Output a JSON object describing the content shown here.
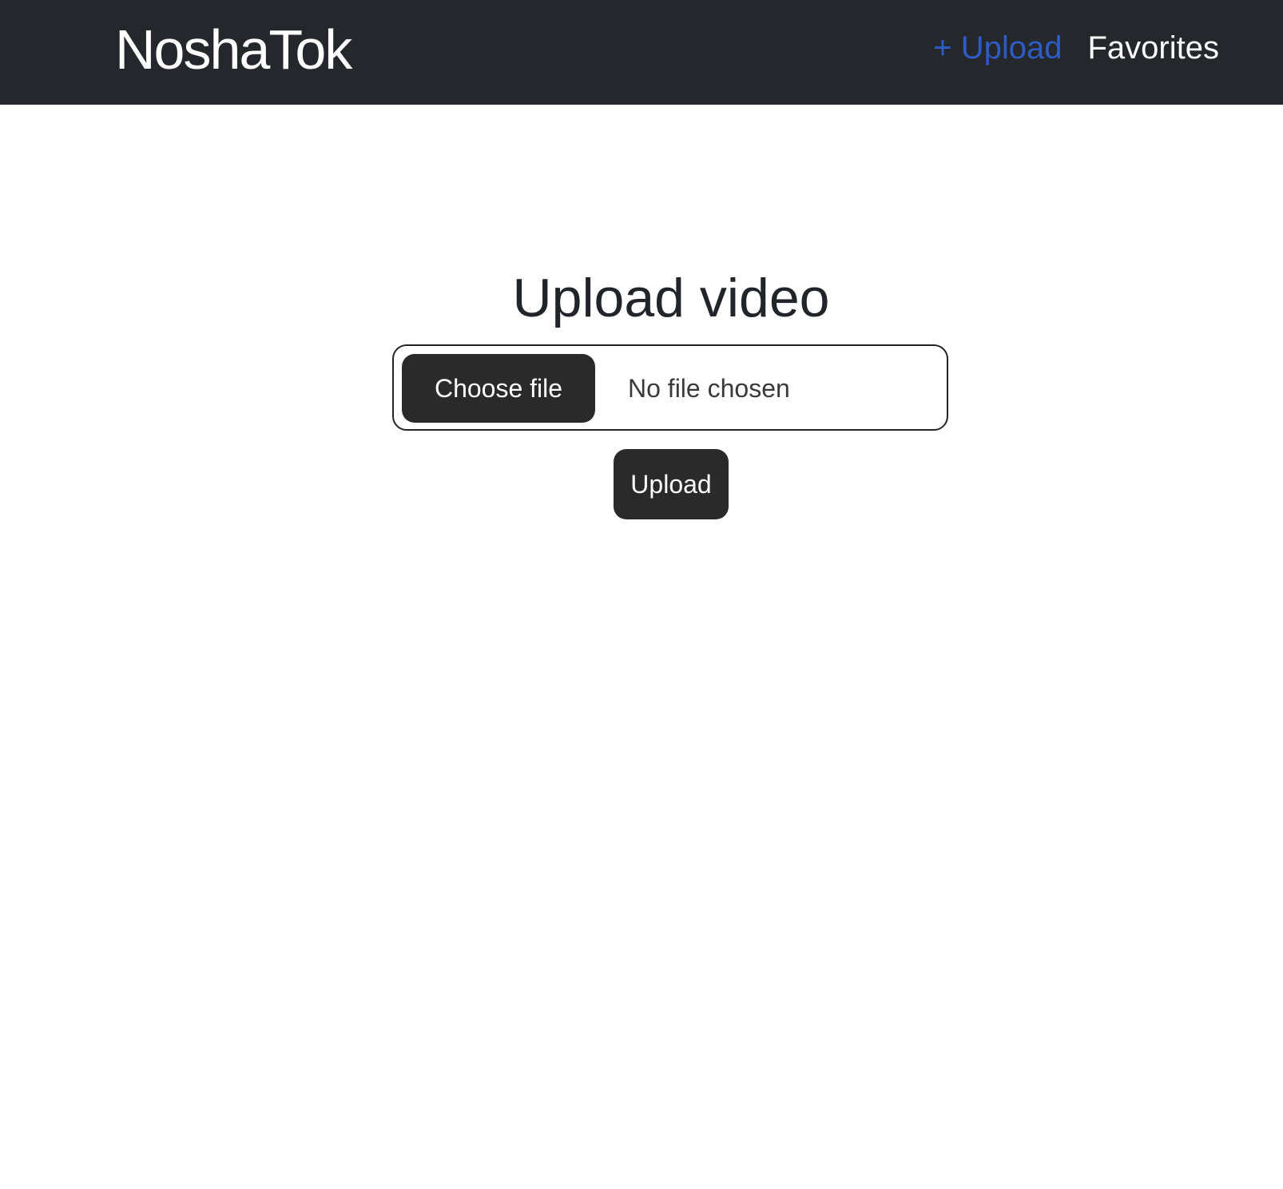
{
  "navbar": {
    "brand": "NoshaTok",
    "links": [
      {
        "label": "+ Upload",
        "active": true
      },
      {
        "label": "Favorites",
        "active": false
      }
    ],
    "background": "#24272c",
    "active_link_color": "#2e5cc4"
  },
  "main": {
    "title": "Upload video",
    "file_input": {
      "button_label": "Choose file",
      "status": "No file chosen"
    },
    "submit_label": "Upload",
    "button_color": "#2a2a2a"
  }
}
